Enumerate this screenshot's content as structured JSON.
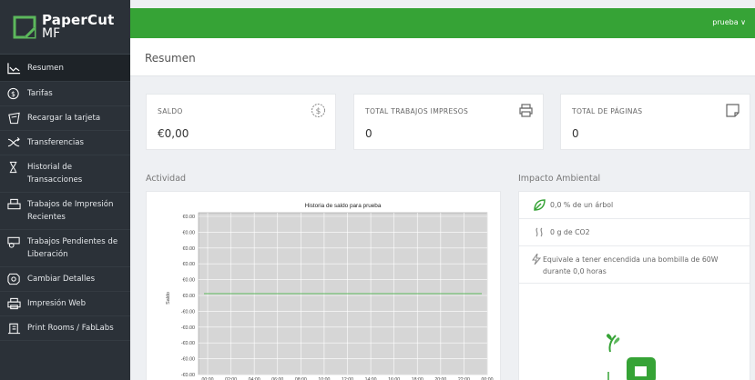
{
  "app": {
    "logo_line1": "PaperCut",
    "logo_line2": "MF",
    "user": "prueba ∨"
  },
  "sidebar": {
    "items": [
      {
        "label": "Resumen",
        "icon": "chart-line-icon"
      },
      {
        "label": "Tarifas",
        "icon": "dollar-circle-icon"
      },
      {
        "label": "Recargar la tarjeta",
        "icon": "gift-card-icon"
      },
      {
        "label": "Transferencias",
        "icon": "transfer-icon"
      },
      {
        "label": "Historial de Transacciones",
        "icon": "hourglass-icon"
      },
      {
        "label": "Trabajos de Impresión Recientes",
        "icon": "print-history-icon"
      },
      {
        "label": "Trabajos Pendientes de Liberación",
        "icon": "pending-print-icon"
      },
      {
        "label": "Cambiar Detalles",
        "icon": "settings-icon"
      },
      {
        "label": "Impresión Web",
        "icon": "web-print-icon"
      },
      {
        "label": "Print Rooms / FabLabs",
        "icon": "print-room-icon"
      }
    ]
  },
  "header": {
    "title": "Resumen"
  },
  "cards": [
    {
      "label": "SALDO",
      "value": "€0,00",
      "icon": "dollar-circle-icon"
    },
    {
      "label": "TOTAL TRABAJOS IMPRESOS",
      "value": "0",
      "icon": "printer-icon"
    },
    {
      "label": "TOTAL DE PÁGINAS",
      "value": "0",
      "icon": "page-icon"
    }
  ],
  "activity": {
    "section_title": "Actividad"
  },
  "chart_data": {
    "type": "line",
    "title": "Historia de saldo para prueba",
    "ylabel": "Saldo",
    "xlabel": "",
    "y_tick_labels": [
      "€0.00",
      "€0.00",
      "€0.00",
      "€0.00",
      "€0.00",
      "€0.00",
      "-€0.00",
      "-€0.00",
      "-€0.00",
      "-€0.00",
      "-€0.00"
    ],
    "x_tick_labels": [
      "00:00",
      "02:00",
      "04:00",
      "06:00",
      "08:00",
      "10:00",
      "12:00",
      "14:00",
      "16:00",
      "18:00",
      "20:00",
      "22:00",
      "00:00"
    ],
    "series": [
      {
        "values": [
          0,
          0
        ]
      }
    ],
    "ylim": [
      -1,
      1
    ],
    "grid": true,
    "colors": {
      "line": "#5cb85c",
      "plot_bg": "#d6d6d6",
      "grid": "#ffffff"
    }
  },
  "environment": {
    "section_title": "Impacto Ambiental",
    "tree": "0,0 % de un árbol",
    "co2": "0 g de CO2",
    "bulb": "Equivale a tener encendida una bombilla de 60W durante 0,0 horas"
  },
  "colors": {
    "brand_green": "#36a336",
    "sidebar_bg": "#2b3138"
  }
}
